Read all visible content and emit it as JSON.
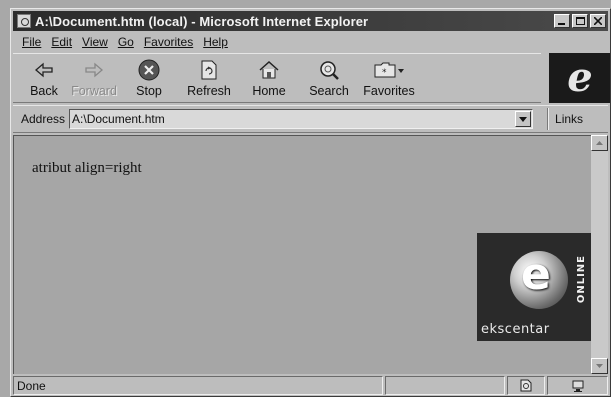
{
  "window": {
    "title": "A:\\Document.htm (local) - Microsoft Internet Explorer",
    "controls": [
      "minimize-icon",
      "maximize-icon",
      "close-icon"
    ]
  },
  "menu": [
    {
      "id": "file",
      "label": "File"
    },
    {
      "id": "edit",
      "label": "Edit"
    },
    {
      "id": "view",
      "label": "View"
    },
    {
      "id": "go",
      "label": "Go"
    },
    {
      "id": "favorites",
      "label": "Favorites"
    },
    {
      "id": "help",
      "label": "Help"
    }
  ],
  "toolbar": [
    {
      "id": "back",
      "label": "Back",
      "icon": "back-arrow-icon",
      "enabled": true
    },
    {
      "id": "forward",
      "label": "Forward",
      "icon": "forward-arrow-icon",
      "enabled": false
    },
    {
      "id": "stop",
      "label": "Stop",
      "icon": "stop-icon",
      "enabled": true
    },
    {
      "id": "refresh",
      "label": "Refresh",
      "icon": "refresh-icon",
      "enabled": true
    },
    {
      "id": "home",
      "label": "Home",
      "icon": "home-icon",
      "enabled": true
    },
    {
      "id": "search",
      "label": "Search",
      "icon": "search-icon",
      "enabled": true
    },
    {
      "id": "favorites",
      "label": "Favorites",
      "icon": "favorites-folder-icon",
      "enabled": true
    }
  ],
  "address": {
    "label": "Address",
    "value": "A:\\Document.htm",
    "links_label": "Links"
  },
  "page": {
    "text": "atribut align=right",
    "logo": {
      "letter": "e",
      "vertical_text": "ONLINE",
      "brand": "ekscentar"
    }
  },
  "status": {
    "text": "Done"
  }
}
